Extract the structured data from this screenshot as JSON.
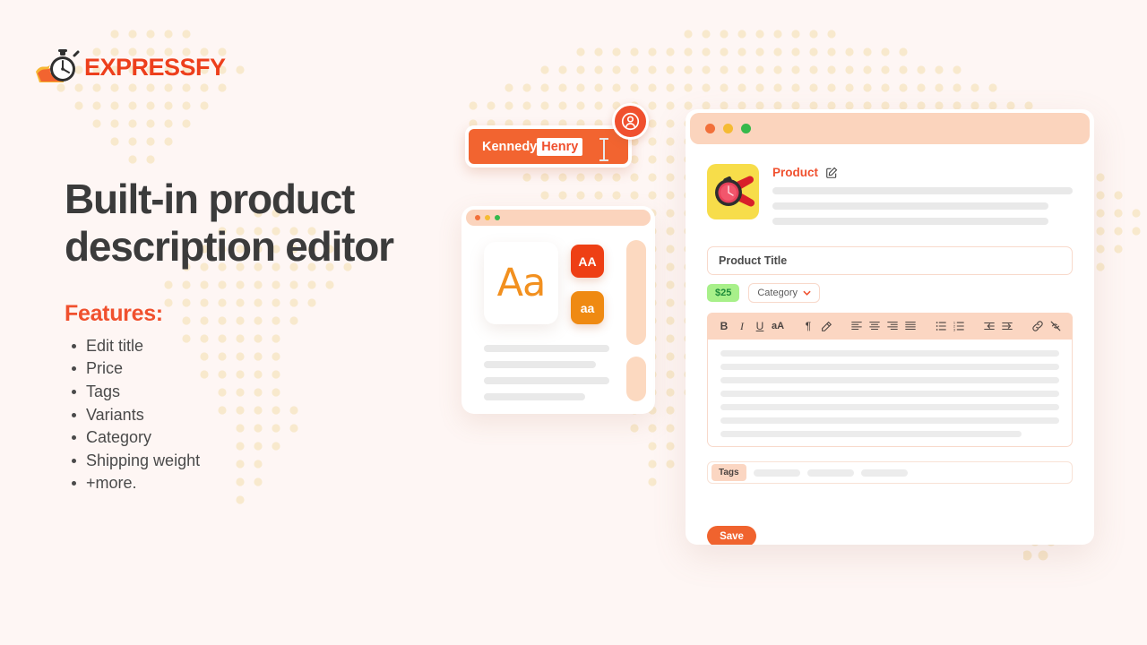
{
  "brand": {
    "name": "EXPRESSFY",
    "logo_icon": "flaming-stopwatch-icon",
    "accent": "#ed3f1c"
  },
  "hero": {
    "headline": "Built-in product description editor",
    "features_title": "Features:",
    "features": [
      "Edit title",
      "Price",
      "Tags",
      "Variants",
      "Category",
      "Shipping weight",
      "+more."
    ]
  },
  "nametag": {
    "text_plain": "Kennedy",
    "text_selected": "Henry",
    "avatar_icon": "user-circle-icon",
    "caret_icon": "text-cursor-icon"
  },
  "font_card": {
    "window_dots": [
      "red",
      "yellow",
      "green"
    ],
    "sample": "Aa",
    "uppercase_chip": "AA",
    "lowercase_chip": "aa",
    "uppercase_color": "#ee3f14",
    "lowercase_color": "#ef8a12",
    "sample_color": "#f2901f"
  },
  "editor_window": {
    "window_dots": [
      "red",
      "yellow",
      "green"
    ],
    "product": {
      "label": "Product",
      "edit_icon": "edit-square-icon",
      "thumb_icon": "wristwatch-image"
    },
    "title_field": {
      "value": "Product Title",
      "placeholder": "Product Title"
    },
    "price_badge": "$25",
    "category_select": {
      "value": "Category",
      "chevron_icon": "chevron-down-icon"
    },
    "toolbar": [
      {
        "icon": "bold-icon",
        "label": "B"
      },
      {
        "icon": "italic-icon",
        "label": "I"
      },
      {
        "icon": "underline-icon",
        "label": "U"
      },
      {
        "icon": "font-size-icon",
        "label": "aA"
      },
      {
        "icon": "paragraph-pilcrow-icon",
        "label": "¶"
      },
      {
        "icon": "highlight-color-icon",
        "label": ""
      },
      {
        "icon": "align-left-icon",
        "label": ""
      },
      {
        "icon": "align-center-icon",
        "label": ""
      },
      {
        "icon": "align-right-icon",
        "label": ""
      },
      {
        "icon": "align-justify-icon",
        "label": ""
      },
      {
        "icon": "bullet-list-icon",
        "label": ""
      },
      {
        "icon": "numbered-list-icon",
        "label": ""
      },
      {
        "icon": "outdent-icon",
        "label": ""
      },
      {
        "icon": "indent-icon",
        "label": ""
      },
      {
        "icon": "link-icon",
        "label": ""
      },
      {
        "icon": "unlink-icon",
        "label": ""
      }
    ],
    "tags_badge": "Tags",
    "save_button": "Save"
  }
}
